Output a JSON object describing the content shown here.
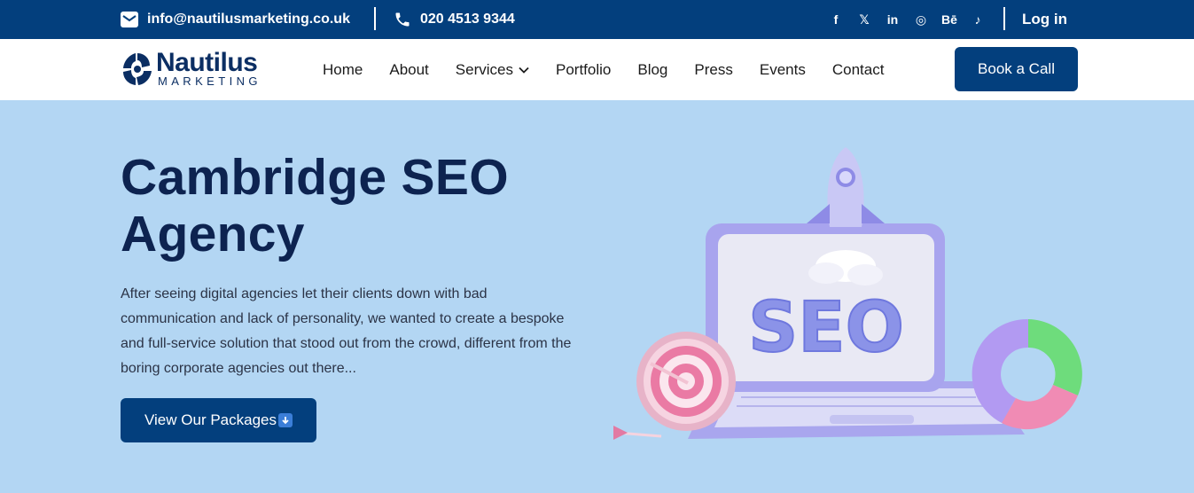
{
  "topbar": {
    "email": "info@nautilusmarketing.co.uk",
    "phone": "020 4513 9344",
    "socials": [
      {
        "name": "facebook-icon",
        "glyph": "f"
      },
      {
        "name": "x-twitter-icon",
        "glyph": "𝕏"
      },
      {
        "name": "linkedin-icon",
        "glyph": "in"
      },
      {
        "name": "instagram-icon",
        "glyph": "◎"
      },
      {
        "name": "behance-icon",
        "glyph": "Bē"
      },
      {
        "name": "tiktok-icon",
        "glyph": "♪"
      }
    ],
    "login": "Log in"
  },
  "logo": {
    "name": "Nautilus",
    "tagline": "MARKETING"
  },
  "nav": {
    "items": [
      "Home",
      "About",
      "Services",
      "Portfolio",
      "Blog",
      "Press",
      "Events",
      "Contact"
    ],
    "cta": "Book a Call"
  },
  "hero": {
    "title": "Cambridge SEO Agency",
    "description": "After seeing digital agencies let their clients down with bad communication and lack of personality, we wanted to create a bespoke and full-service solution that stood out from the crowd, different from the boring corporate agencies out there...",
    "button": "View Our Packages",
    "illustration_text": "SEO"
  },
  "colors": {
    "brand_navy": "#033f7d",
    "hero_bg": "#b3d6f3",
    "heading": "#0d2350"
  }
}
